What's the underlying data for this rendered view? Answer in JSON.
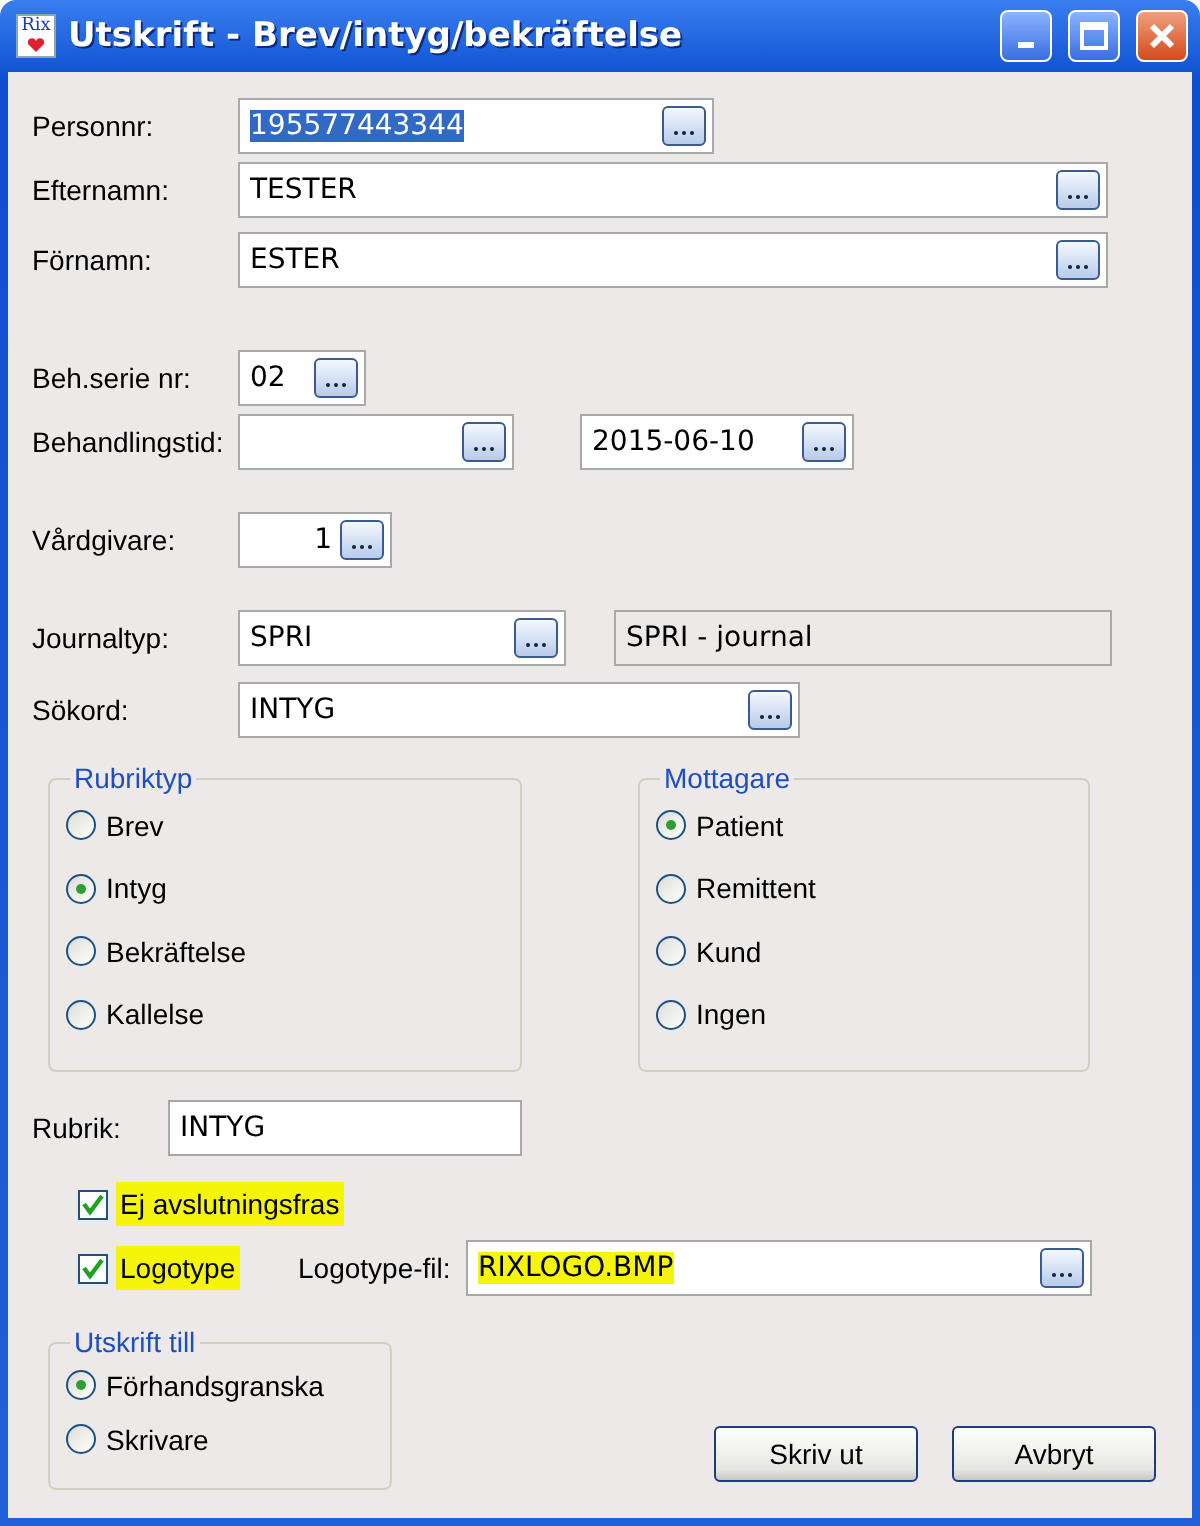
{
  "window": {
    "title": "Utskrift - Brev/intyg/bekräftelse",
    "icon_text": "Rix"
  },
  "patient_fields": [
    {
      "label": "Personnr:",
      "value": "195577443344",
      "selected": true
    },
    {
      "label": "Efternamn:",
      "value": "TESTER",
      "selected": false
    },
    {
      "label": "Förnamn:",
      "value": "ESTER",
      "selected": false
    }
  ],
  "series": {
    "label": "Beh.serie nr:",
    "value": "02"
  },
  "treatment_time": {
    "label": "Behandlingstid:",
    "to": "2015-06-10"
  },
  "care_giver": {
    "label": "Vårdgivare:",
    "value": "1"
  },
  "journal_type": {
    "label": "Journaltyp:",
    "value": "SPRI",
    "description": "SPRI - journal"
  },
  "keyword": {
    "label": "Sökord:",
    "value": "INTYG"
  },
  "groups": [
    {
      "title": "Rubriktyp",
      "options": [
        {
          "label": "Brev",
          "selected": false
        },
        {
          "label": "Intyg",
          "selected": true
        },
        {
          "label": "Bekräftelse",
          "selected": false
        },
        {
          "label": "Kallelse",
          "selected": false
        }
      ]
    },
    {
      "title": "Mottagare",
      "options": [
        {
          "label": "Patient",
          "selected": true
        },
        {
          "label": "Remittent",
          "selected": false
        },
        {
          "label": "Kund",
          "selected": false
        },
        {
          "label": "Ingen",
          "selected": false
        }
      ]
    }
  ],
  "heading": {
    "label": "Rubrik:",
    "value": "INTYG"
  },
  "options": [
    {
      "label": "Ej avslutningsfras",
      "checked": true,
      "highlighted": true
    },
    {
      "label": "Logotype",
      "checked": true,
      "highlighted": true
    }
  ],
  "logo_file": {
    "label": "Logotype-fil:",
    "value": "RIXLOGO.BMP",
    "highlighted": true
  },
  "output": {
    "title": "Utskrift till",
    "options": [
      {
        "label": "Förhandsgranska",
        "selected": true
      },
      {
        "label": "Skrivare",
        "selected": false
      }
    ]
  },
  "buttons": [
    "Skriv ut",
    "Avbryt"
  ]
}
